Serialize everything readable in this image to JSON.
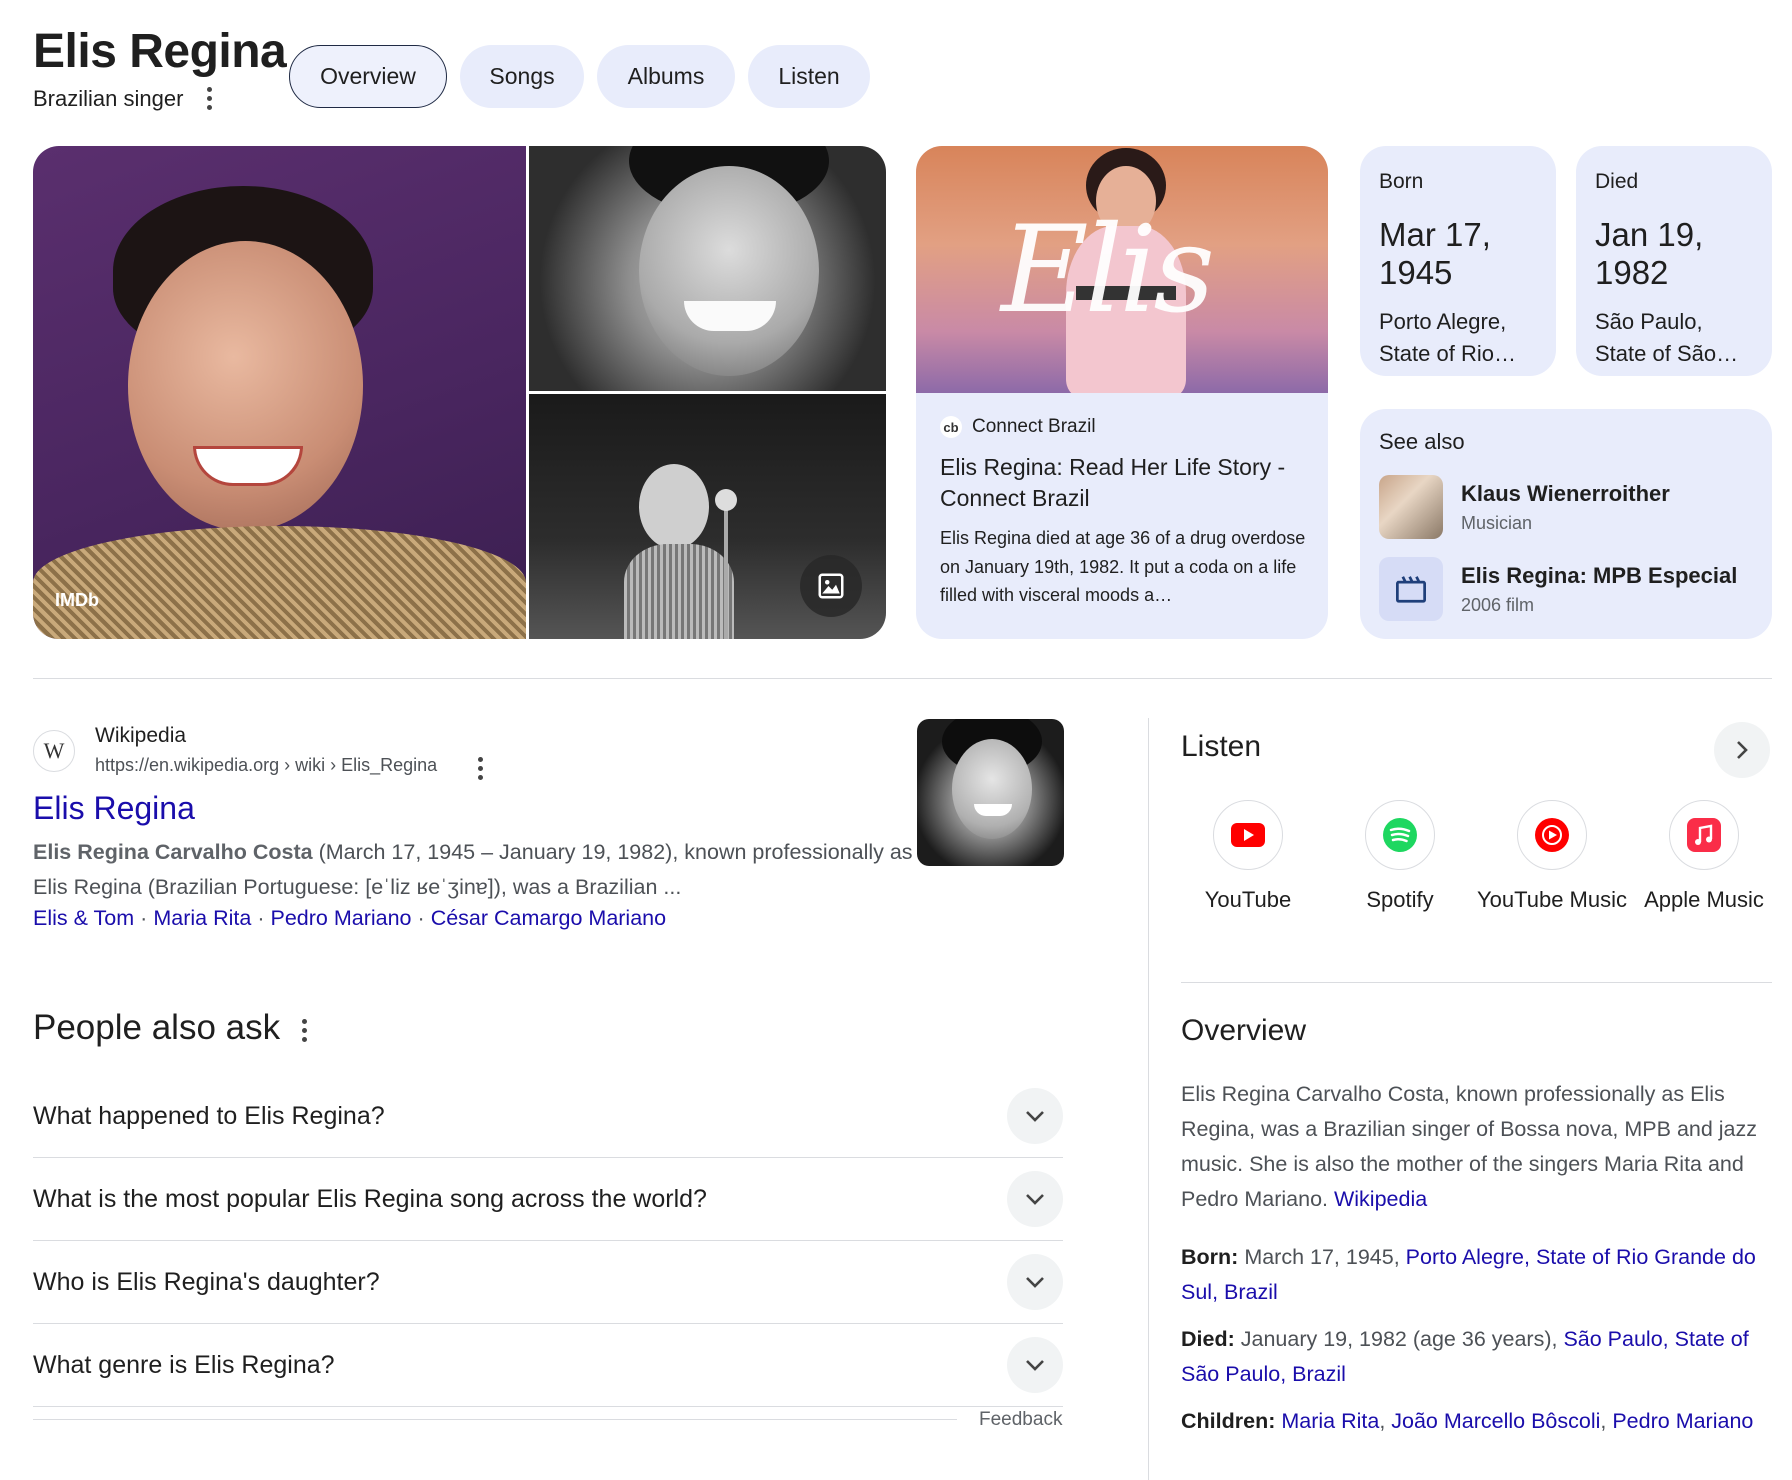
{
  "header": {
    "title": "Elis Regina",
    "subtitle": "Brazilian singer",
    "tabs": [
      {
        "label": "Overview",
        "active": true
      },
      {
        "label": "Songs",
        "active": false
      },
      {
        "label": "Albums",
        "active": false
      },
      {
        "label": "Listen",
        "active": false
      }
    ]
  },
  "images": {
    "main_credit": "IMDb"
  },
  "article": {
    "source": "Connect Brazil",
    "source_logo": "cb",
    "image_caption": "Elis",
    "title": "Elis Regina: Read Her Life Story - Connect Brazil",
    "snippet": "Elis Regina died at age 36 of a drug overdose on January 19th, 1982. It put a coda on a life filled with visceral moods a…"
  },
  "born": {
    "label": "Born",
    "date": "Mar 17, 1945",
    "place": "Porto Alegre,\nState of Rio…"
  },
  "died": {
    "label": "Died",
    "date": "Jan 19, 1982",
    "place": "São Paulo,\nState of São…"
  },
  "see_also": {
    "title": "See also",
    "items": [
      {
        "name": "Klaus Wienerroither",
        "sub": "Musician"
      },
      {
        "name": "Elis Regina: MPB Especial",
        "sub": "2006 film"
      }
    ]
  },
  "wiki": {
    "favicon": "W",
    "site": "Wikipedia",
    "url": "https://en.wikipedia.org › wiki › Elis_Regina",
    "title": "Elis Regina",
    "snippet_bold": "Elis Regina Carvalho Costa",
    "snippet_rest": " (March 17, 1945 – January 19, 1982), known professionally as Elis Regina (Brazilian Portuguese: [eˈliz ʁeˈʒinɐ]), was a Brazilian ...",
    "links": [
      "Elis & Tom",
      "Maria Rita",
      "Pedro Mariano",
      "César Camargo Mariano"
    ],
    "link_sep": "·"
  },
  "paa": {
    "title": "People also ask",
    "questions": [
      "What happened to Elis Regina?",
      "What is the most popular Elis Regina song across the world?",
      "Who is Elis Regina's daughter?",
      "What genre is Elis Regina?"
    ],
    "feedback": "Feedback"
  },
  "listen": {
    "title": "Listen",
    "providers": [
      {
        "name": "YouTube",
        "icon": "youtube-icon",
        "color": "#ff0000"
      },
      {
        "name": "Spotify",
        "icon": "spotify-icon",
        "color": "#1ed760"
      },
      {
        "name": "YouTube Music",
        "icon": "youtube-music-icon",
        "color": "#ff0000"
      },
      {
        "name": "Apple Music",
        "icon": "apple-music-icon",
        "color": "#fa2d48"
      }
    ]
  },
  "overview": {
    "title": "Overview",
    "text": "Elis Regina Carvalho Costa, known professionally as Elis Regina, was a Brazilian singer of Bossa nova, MPB and jazz music. She is also the mother of the singers Maria Rita and Pedro Mariano.",
    "source_link": "Wikipedia",
    "born_label": "Born:",
    "born_text": "March 17, 1945,",
    "born_link": "Porto Alegre, State of Rio Grande do Sul, Brazil",
    "died_label": "Died:",
    "died_text": "January 19, 1982 (age 36 years),",
    "died_link": "São Paulo, State of São Paulo, Brazil",
    "children_label": "Children:",
    "children": [
      "Maria Rita",
      "João Marcello Bôscoli",
      "Pedro Mariano"
    ]
  },
  "colors": {
    "accent_link": "#1a0dab",
    "card_bg": "#e8ecfb",
    "muted_text": "#4d5156"
  }
}
